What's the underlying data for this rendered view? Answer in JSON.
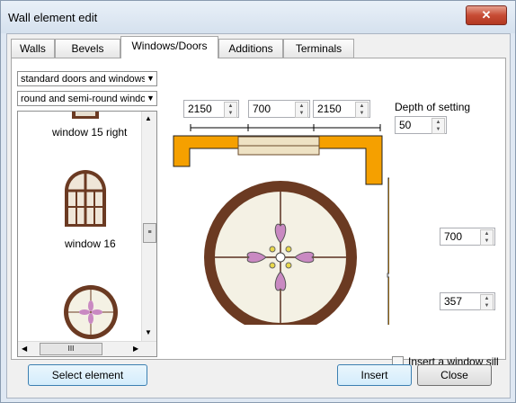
{
  "window": {
    "title": "Wall element edit",
    "close_symbol": "✕"
  },
  "tabs": [
    {
      "label": "Walls"
    },
    {
      "label": "Bevels"
    },
    {
      "label": "Windows/Doors"
    },
    {
      "label": "Additions"
    },
    {
      "label": "Terminals"
    }
  ],
  "active_tab": "Windows/Doors",
  "filters": {
    "category": "standard doors and windows",
    "subcategory": "round and semi-round windows"
  },
  "element_list": {
    "items": [
      {
        "label": "window 15 right"
      },
      {
        "label": "window 16"
      },
      {
        "label": ""
      }
    ],
    "scrollbar_thumb_glyph": "III"
  },
  "dimensions": {
    "left": "2150",
    "width": "700",
    "right": "2150",
    "depth_label": "Depth of setting",
    "depth": "50",
    "height": "700",
    "sill_height": "357"
  },
  "sill_checkbox": {
    "label": "Insert a window sill",
    "checked": false
  },
  "buttons": {
    "select_element": "Select element",
    "insert": "Insert",
    "close": "Close"
  },
  "colors": {
    "wall": "#f5a000",
    "frame": "#6b3a22",
    "glass": "#f4f1e4",
    "petal": "#c989c2"
  }
}
